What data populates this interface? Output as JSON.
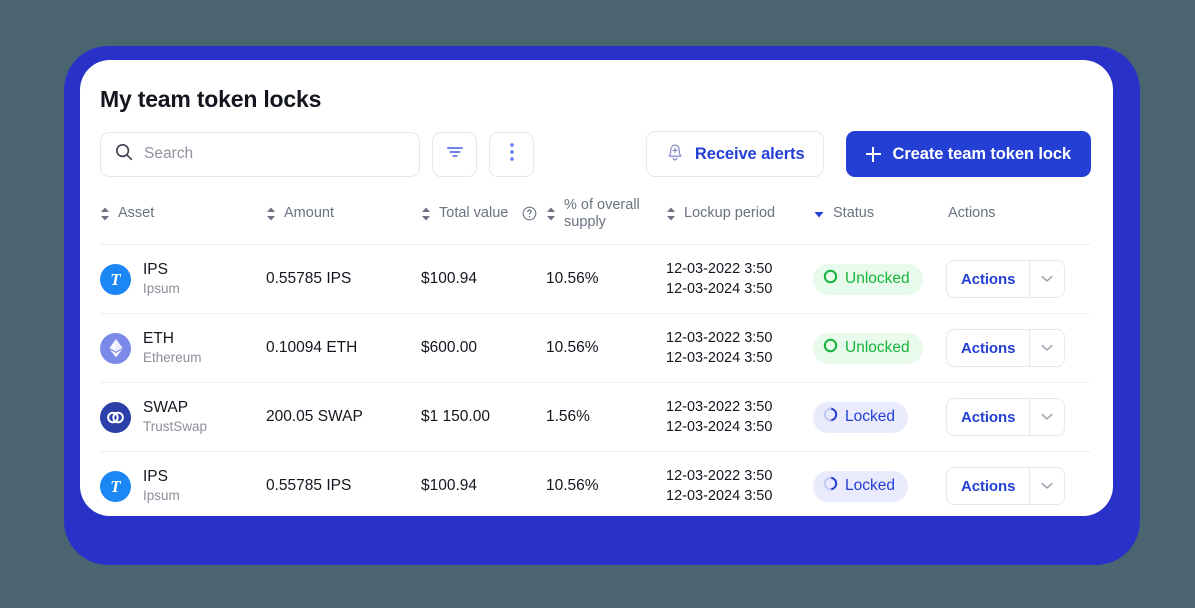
{
  "page": {
    "title": "My team token locks"
  },
  "toolbar": {
    "search_placeholder": "Search",
    "search_value": "",
    "filter_icon": "filter-icon",
    "more_icon": "more-vertical-icon",
    "receive_alerts_label": "Receive alerts",
    "receive_alerts_icon": "bell-plus-icon",
    "create_lock_label": "Create team token lock",
    "create_lock_icon": "plus-icon"
  },
  "colors": {
    "primary": "#2440d4",
    "panel_blue": "#2832c8",
    "page_background": "#4a6570",
    "unlocked_text": "#16b53a",
    "unlocked_bg": "#e8faec",
    "locked_text": "#2440d4",
    "locked_bg": "#e9eafc",
    "card_white": "#ffffff",
    "muted_text": "#6b7280"
  },
  "table": {
    "columns": [
      {
        "key": "asset",
        "label": "Asset",
        "sortable": true,
        "sorted": false,
        "help": false
      },
      {
        "key": "amount",
        "label": "Amount",
        "sortable": true,
        "sorted": false,
        "help": false
      },
      {
        "key": "value",
        "label": "Total value",
        "sortable": true,
        "sorted": false,
        "help": true
      },
      {
        "key": "supply",
        "label": "% of overall supply",
        "sortable": true,
        "sorted": false,
        "help": false
      },
      {
        "key": "lockup",
        "label": "Lockup period",
        "sortable": true,
        "sorted": false,
        "help": false
      },
      {
        "key": "status",
        "label": "Status",
        "sortable": true,
        "sorted": true,
        "help": false
      },
      {
        "key": "actions",
        "label": "Actions",
        "sortable": false,
        "sorted": false,
        "help": false
      }
    ],
    "rows": [
      {
        "symbol": "IPS",
        "name": "Ipsum",
        "icon": "ips-token-icon",
        "amount": "0.55785 IPS",
        "total_value": "$100.94",
        "percent_supply": "10.56%",
        "lockup_start": "12-03-2022 3:50",
        "lockup_end": "12-03-2024 3:50",
        "status": "Unlocked",
        "status_state": "unlocked",
        "actions_label": "Actions"
      },
      {
        "symbol": "ETH",
        "name": "Ethereum",
        "icon": "eth-token-icon",
        "amount": "0.10094 ETH",
        "total_value": "$600.00",
        "percent_supply": "10.56%",
        "lockup_start": "12-03-2022 3:50",
        "lockup_end": "12-03-2024 3:50",
        "status": "Unlocked",
        "status_state": "unlocked",
        "actions_label": "Actions"
      },
      {
        "symbol": "SWAP",
        "name": "TrustSwap",
        "icon": "swap-token-icon",
        "amount": "200.05 SWAP",
        "total_value": "$1 150.00",
        "percent_supply": "1.56%",
        "lockup_start": "12-03-2022 3:50",
        "lockup_end": "12-03-2024 3:50",
        "status": "Locked",
        "status_state": "locked",
        "actions_label": "Actions"
      },
      {
        "symbol": "IPS",
        "name": "Ipsum",
        "icon": "ips-token-icon",
        "amount": "0.55785 IPS",
        "total_value": "$100.94",
        "percent_supply": "10.56%",
        "lockup_start": "12-03-2022 3:50",
        "lockup_end": "12-03-2024 3:50",
        "status": "Locked",
        "status_state": "locked",
        "actions_label": "Actions"
      }
    ]
  }
}
